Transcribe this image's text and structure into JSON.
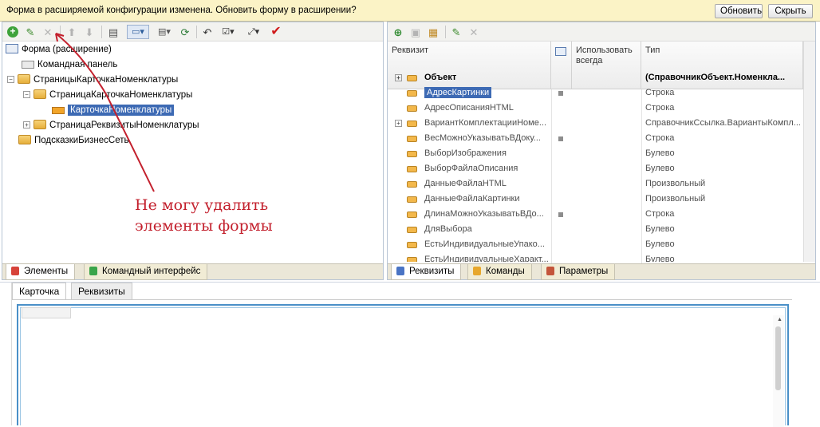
{
  "notification": {
    "message": "Форма в расширяемой конфигурации изменена. Обновить форму в расширении?",
    "update_label": "Обновить",
    "hide_label": "Скрыть"
  },
  "elements_panel": {
    "toolbar_icons": [
      "add-icon",
      "edit-icon",
      "delete-icon",
      "move-up-icon",
      "move-down-icon",
      "properties-icon",
      "view-mode-icon",
      "layout-icon",
      "refresh-icon",
      "undo-icon",
      "checkbox-icon",
      "expand-icon",
      "check-icon"
    ],
    "tree": [
      {
        "label": "Форма (расширение)",
        "level": 0,
        "icon": "form-icon",
        "expander": false
      },
      {
        "label": "Командная панель",
        "level": 1,
        "icon": "command-bar-icon",
        "expander": false
      },
      {
        "label": "СтраницыКарточкаНоменклатуры",
        "level": 0,
        "icon": "folder-icon",
        "expander": "minus"
      },
      {
        "label": "СтраницаКарточкаНоменклатуры",
        "level": 1,
        "icon": "folder-icon",
        "expander": "minus"
      },
      {
        "label": "КарточкаНоменклатуры",
        "level": 2,
        "icon": "item-icon",
        "expander": false,
        "selected": true
      },
      {
        "label": "СтраницаРеквизитыНоменклатуры",
        "level": 1,
        "icon": "folder-icon",
        "expander": "plus"
      },
      {
        "label": "ПодсказкиБизнесСеть",
        "level": 0,
        "icon": "folder-icon",
        "expander": false
      }
    ],
    "tabs": [
      "Элементы",
      "Командный интерфейс"
    ]
  },
  "annotation": {
    "line1": "Не могу удалить",
    "line2": "элементы формы",
    "color": "#c3202d"
  },
  "requisites_panel": {
    "toolbar_icons": [
      "add-requisite-icon",
      "add-copy-icon",
      "add-column-icon",
      "edit-icon",
      "delete-icon"
    ],
    "columns": [
      "Реквизит",
      "Использовать всегда",
      "Тип"
    ],
    "rows": [
      {
        "name": "Объект",
        "always": false,
        "type": "(СправочникОбъект.Номенкла...",
        "bold": true,
        "expandable": true
      },
      {
        "name": "АдресКартинки",
        "always": true,
        "type": "Строка",
        "selected": true
      },
      {
        "name": "АдресОписанияHTML",
        "always": false,
        "type": "Строка"
      },
      {
        "name": "ВариантКомплектацииНоме...",
        "always": false,
        "type": "СправочникСсылка.ВариантыКомпл...",
        "expandable": true
      },
      {
        "name": "ВесМожноУказыватьВДоку...",
        "always": true,
        "type": "Строка"
      },
      {
        "name": "ВыборИзображения",
        "always": false,
        "type": "Булево"
      },
      {
        "name": "ВыборФайлаОписания",
        "always": false,
        "type": "Булево"
      },
      {
        "name": "ДанныеФайлаHTML",
        "always": false,
        "type": "Произвольный"
      },
      {
        "name": "ДанныеФайлаКартинки",
        "always": false,
        "type": "Произвольный"
      },
      {
        "name": "ДлинаМожноУказыватьВДо...",
        "always": true,
        "type": "Строка"
      },
      {
        "name": "ДляВыбора",
        "always": false,
        "type": "Булево"
      },
      {
        "name": "ЕстьИндивидуальныеУпако...",
        "always": false,
        "type": "Булево"
      },
      {
        "name": "ЕстьИндивидуальныеХаракт...",
        "always": false,
        "type": "Булево"
      }
    ],
    "tabs": [
      "Реквизиты",
      "Команды",
      "Параметры"
    ]
  },
  "designer": {
    "tabs": [
      "Карточка",
      "Реквизиты"
    ]
  },
  "colors": {
    "notification_bg": "#fbf3c6",
    "selection": "#3d6ab4",
    "accent_border": "#4a90c8",
    "annotation": "#c3202d"
  }
}
